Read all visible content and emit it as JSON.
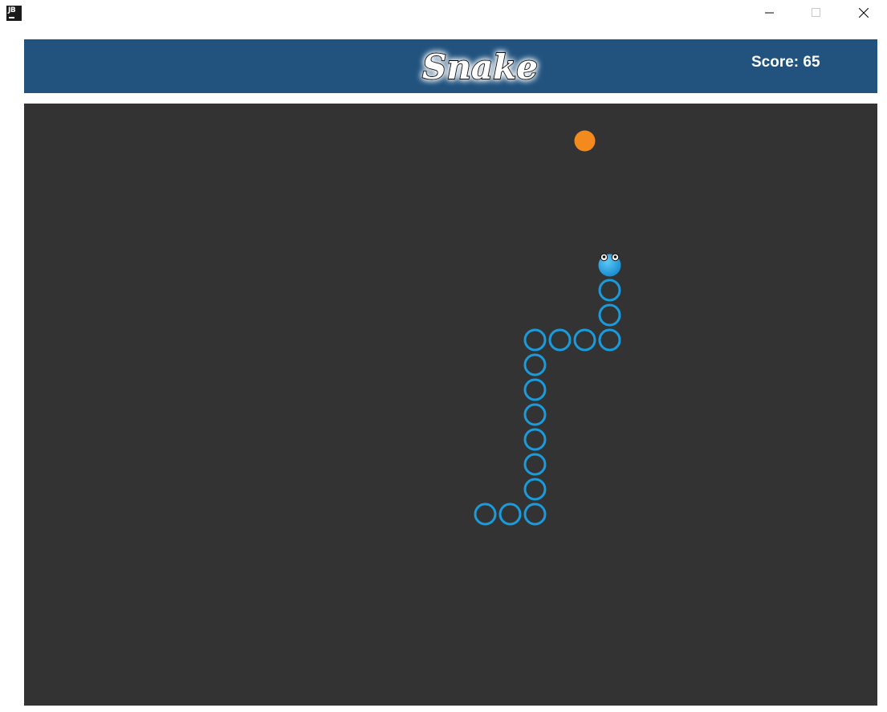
{
  "window": {
    "icon_text": "JB",
    "minimize_icon": "minimize-icon",
    "maximize_icon": "maximize-icon",
    "close_icon": "close-icon"
  },
  "header": {
    "logo_text": "Snake",
    "score_text": "Score: 65"
  },
  "game": {
    "score": 65,
    "cell_size": 31,
    "colors": {
      "board": "#333333",
      "header": "#22537f",
      "snake": "#1a9bdc",
      "food": "#f28a1e"
    },
    "snake_head": {
      "col": 23,
      "row": 6,
      "direction": "up"
    },
    "snake_body": [
      {
        "col": 23,
        "row": 7
      },
      {
        "col": 23,
        "row": 8
      },
      {
        "col": 23,
        "row": 9
      },
      {
        "col": 22,
        "row": 9
      },
      {
        "col": 21,
        "row": 9
      },
      {
        "col": 20,
        "row": 9
      },
      {
        "col": 20,
        "row": 10
      },
      {
        "col": 20,
        "row": 11
      },
      {
        "col": 20,
        "row": 12
      },
      {
        "col": 20,
        "row": 13
      },
      {
        "col": 20,
        "row": 14
      },
      {
        "col": 20,
        "row": 15
      },
      {
        "col": 20,
        "row": 16
      },
      {
        "col": 19,
        "row": 16
      },
      {
        "col": 18,
        "row": 16
      }
    ],
    "food": {
      "col": 22,
      "row": 1
    }
  }
}
